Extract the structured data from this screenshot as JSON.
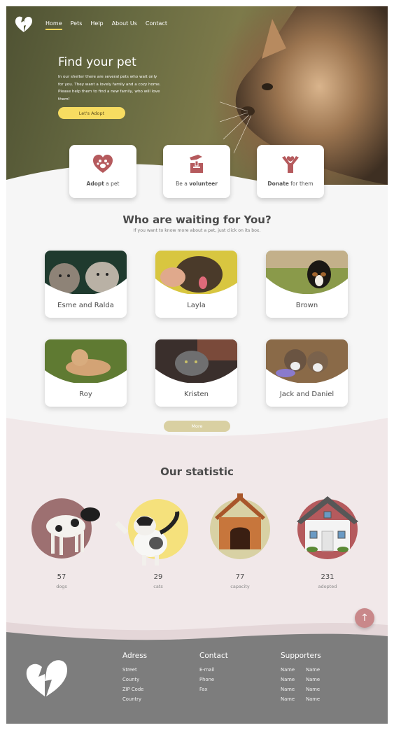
{
  "nav": {
    "items": [
      "Home",
      "Pets",
      "Help",
      "About Us",
      "Contact"
    ],
    "active": "Home"
  },
  "hero": {
    "title": "Find your pet",
    "text1": "In our shelter there are several pets who wait only for you. They want a lovely family and a cozy home.",
    "text2": "Please help them to find a new family, who will love them!",
    "button": "Let's Adopt"
  },
  "actions": [
    {
      "bold": "Adopt",
      "rest": " a pet",
      "icon": "heart-paw-icon"
    },
    {
      "pre": "Be a ",
      "bold": "volunteer",
      "icon": "hand-box-icon"
    },
    {
      "bold": "Donate",
      "rest": " for them",
      "icon": "person-heart-icon"
    }
  ],
  "waiting": {
    "title": "Who are waiting for You?",
    "subtitle": "If you want to know more about a pet, just click on its box.",
    "pets": [
      "Esme and Ralda",
      "Layla",
      "Brown",
      "Roy",
      "Kristen",
      "Jack and Daniel"
    ],
    "more": "More"
  },
  "stats": {
    "title": "Our statistic",
    "items": [
      {
        "value": "57",
        "label": "dogs",
        "color": "#9d7071"
      },
      {
        "value": "29",
        "label": "cats",
        "color": "#f5e17c"
      },
      {
        "value": "77",
        "label": "capacity",
        "color": "#d8d1a4"
      },
      {
        "value": "231",
        "label": "adopted",
        "color": "#b55a5d"
      }
    ]
  },
  "footer": {
    "address": {
      "title": "Adress",
      "lines": [
        "Street",
        "County",
        "ZIP Code",
        "Country"
      ]
    },
    "contact": {
      "title": "Contact",
      "lines": [
        "E-mail",
        "Phone",
        "Fax"
      ]
    },
    "supporters": {
      "title": "Supporters",
      "names": [
        [
          "Name",
          "Name"
        ],
        [
          "Name",
          "Name"
        ],
        [
          "Name",
          "Name"
        ],
        [
          "Name",
          "Name"
        ]
      ]
    }
  },
  "colors": {
    "accent": "#f7dc61",
    "brand": "#b55a5d",
    "footer": "#7d7d7d",
    "stats_bg": "#f1e8e9"
  }
}
